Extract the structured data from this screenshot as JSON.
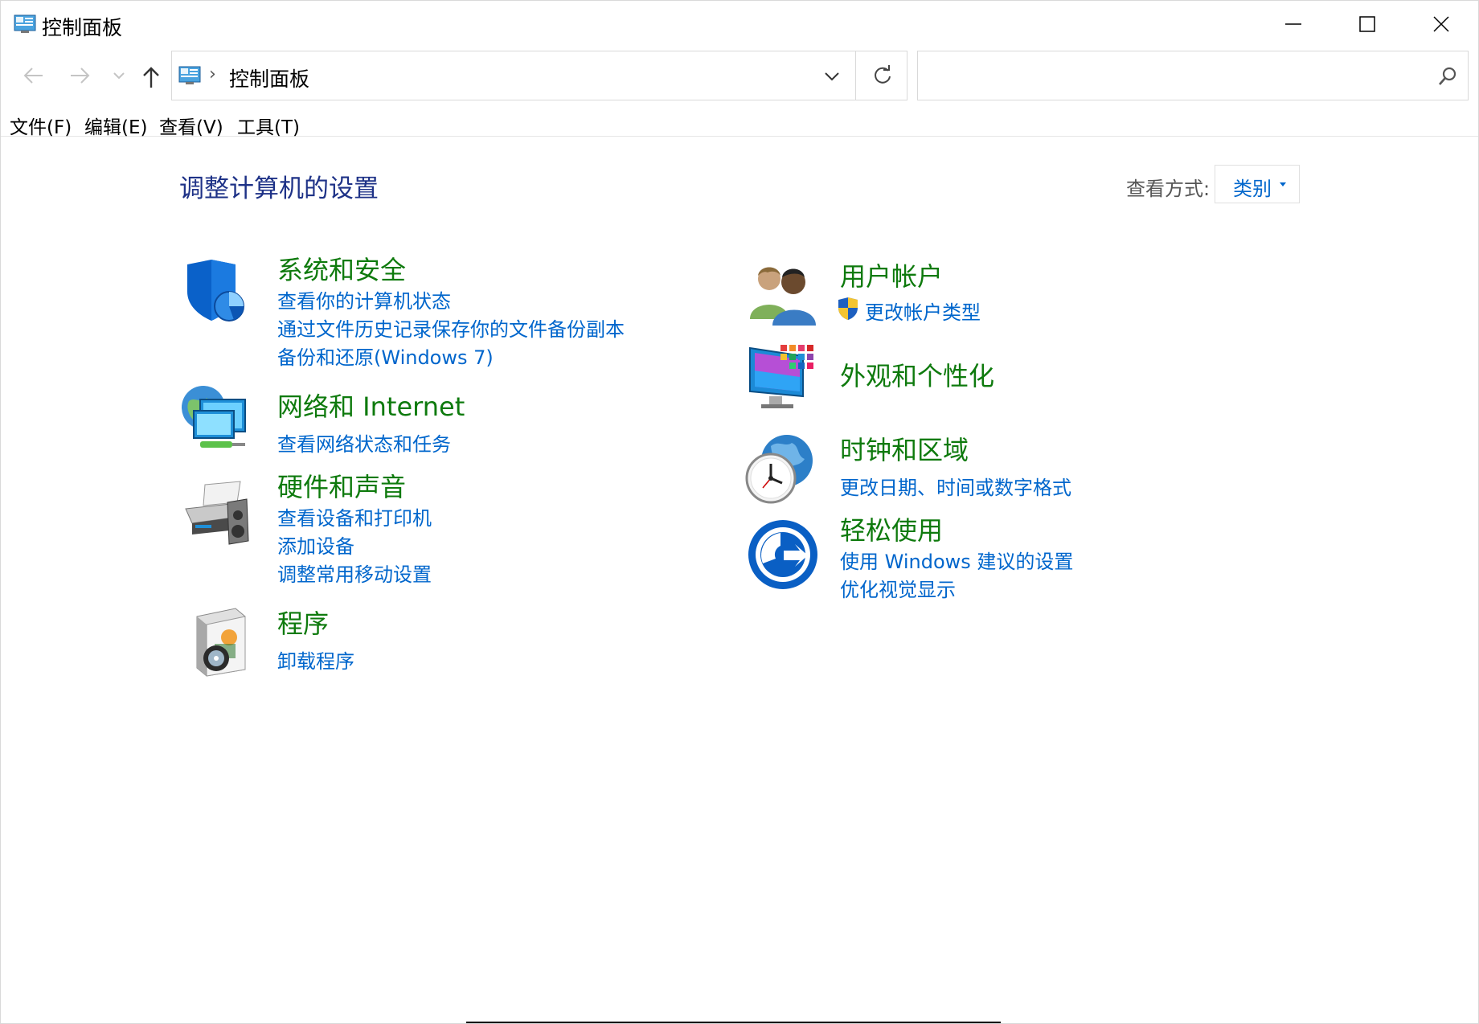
{
  "window": {
    "title": "控制面板"
  },
  "address": {
    "path": [
      "控制面板"
    ],
    "search_placeholder": ""
  },
  "menu": [
    "文件(F)",
    "编辑(E)",
    "查看(V)",
    "工具(T)"
  ],
  "heading": "调整计算机的设置",
  "view_by": {
    "label": "查看方式:",
    "value": "类别"
  },
  "categories": [
    {
      "title": "系统和安全",
      "icon": "shield-icon",
      "links": [
        "查看你的计算机状态",
        "通过文件历史记录保存你的文件备份副本",
        "备份和还原(Windows 7)"
      ]
    },
    {
      "title": "网络和 Internet",
      "icon": "network-globe-icon",
      "links": [
        "查看网络状态和任务"
      ]
    },
    {
      "title": "硬件和声音",
      "icon": "printer-speaker-icon",
      "links": [
        "查看设备和打印机",
        "添加设备",
        "调整常用移动设置"
      ]
    },
    {
      "title": "程序",
      "icon": "programs-disc-icon",
      "links": [
        "卸载程序"
      ]
    },
    {
      "title": "用户帐户",
      "icon": "users-icon",
      "links": [
        "更改帐户类型"
      ]
    },
    {
      "title": "外观和个性化",
      "icon": "monitor-palette-icon",
      "links": []
    },
    {
      "title": "时钟和区域",
      "icon": "clock-globe-icon",
      "links": [
        "更改日期、时间或数字格式"
      ]
    },
    {
      "title": "轻松使用",
      "icon": "ease-of-access-icon",
      "links": [
        "使用 Windows 建议的设置",
        "优化视觉显示"
      ]
    }
  ],
  "colors": {
    "heading": "#1e3287",
    "category_title": "#0e7a0d",
    "link": "#0066cc"
  }
}
